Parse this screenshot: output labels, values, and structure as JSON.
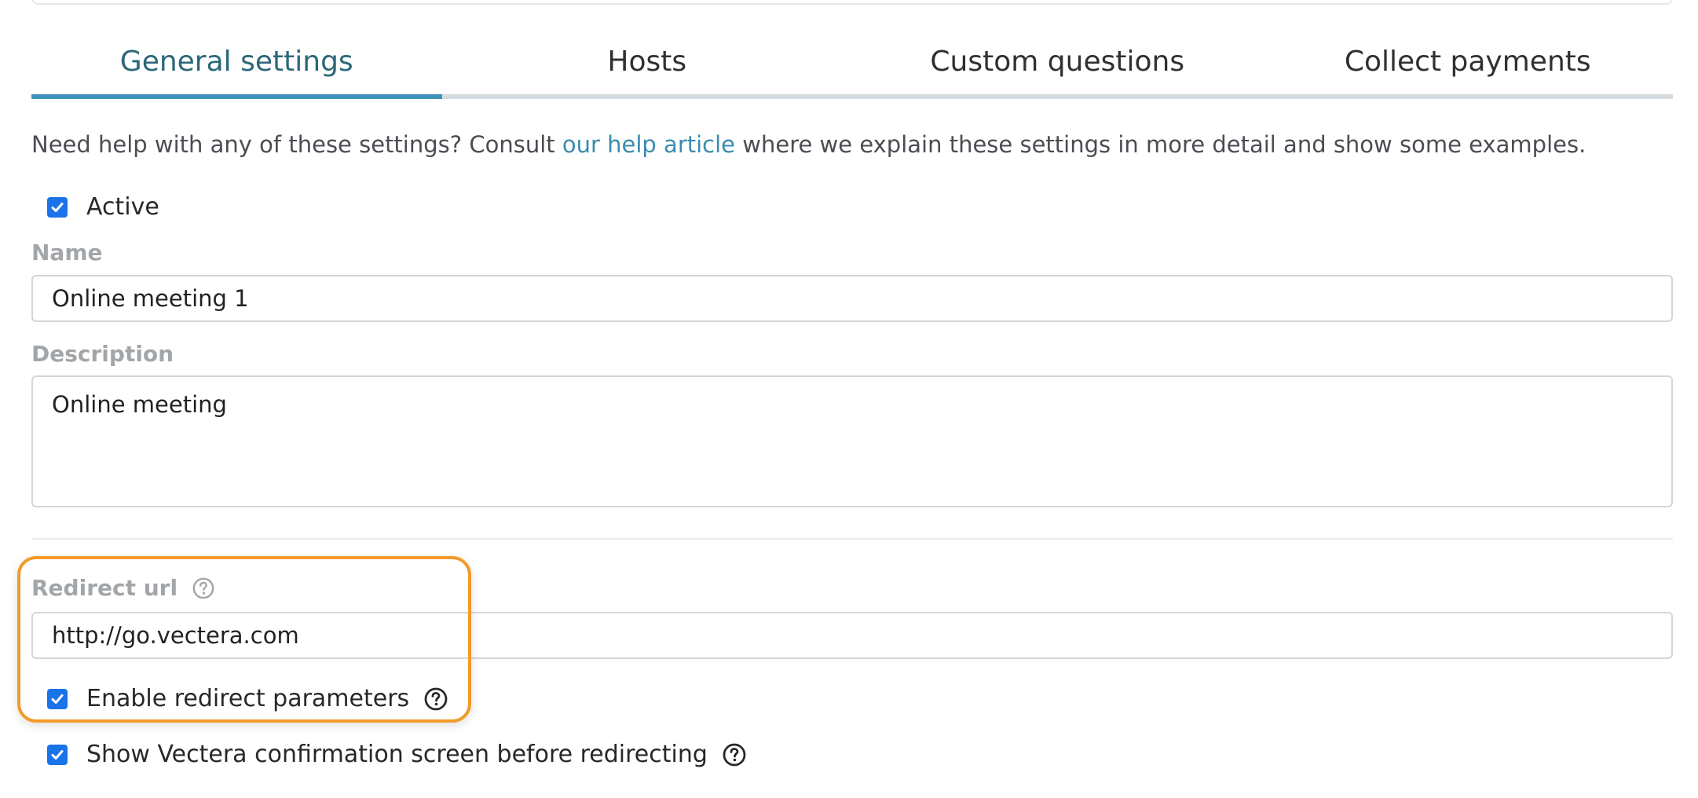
{
  "tabs": [
    {
      "label": "General settings",
      "active": true
    },
    {
      "label": "Hosts",
      "active": false
    },
    {
      "label": "Custom questions",
      "active": false
    },
    {
      "label": "Collect payments",
      "active": false
    }
  ],
  "help": {
    "prefix": "Need help with any of these settings? Consult ",
    "link_text": "our help article",
    "suffix": " where we explain these settings in more detail and show some examples."
  },
  "active_checkbox": {
    "label": "Active",
    "checked": true
  },
  "name_field": {
    "label": "Name",
    "value": "Online meeting 1"
  },
  "description_field": {
    "label": "Description",
    "value": "Online meeting"
  },
  "redirect_field": {
    "label": "Redirect url",
    "value": "http://go.vectera.com"
  },
  "redirect_params_checkbox": {
    "label": "Enable redirect parameters",
    "checked": true
  },
  "confirmation_checkbox": {
    "label": "Show Vectera confirmation screen before redirecting",
    "checked": true
  },
  "colors": {
    "accent": "#3f93b8",
    "active_tab_text": "#2b6777",
    "checkbox": "#1a73e8",
    "highlight": "#f39a2a",
    "label": "#a3a6a9"
  },
  "icons": [
    "checkmark-icon",
    "question-circle-icon"
  ]
}
